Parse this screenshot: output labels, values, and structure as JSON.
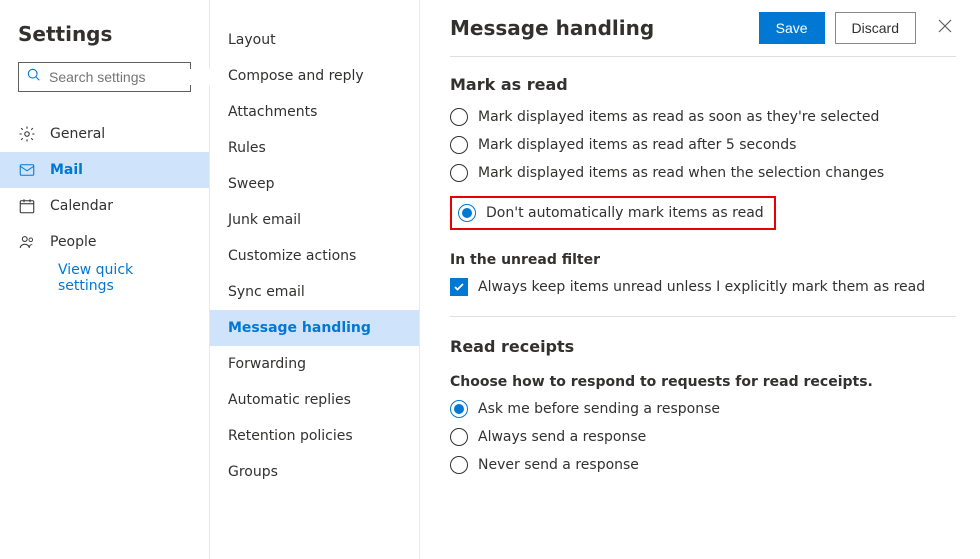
{
  "header": {
    "settings_title": "Settings",
    "search_placeholder": "Search settings"
  },
  "left_nav": {
    "general": "General",
    "mail": "Mail",
    "calendar": "Calendar",
    "people": "People",
    "quick_settings": "View quick settings"
  },
  "mid_nav": {
    "layout": "Layout",
    "compose": "Compose and reply",
    "attachments": "Attachments",
    "rules": "Rules",
    "sweep": "Sweep",
    "junk": "Junk email",
    "customize": "Customize actions",
    "sync": "Sync email",
    "message_handling": "Message handling",
    "forwarding": "Forwarding",
    "auto_replies": "Automatic replies",
    "retention": "Retention policies",
    "groups": "Groups"
  },
  "panel": {
    "title": "Message handling",
    "save": "Save",
    "discard": "Discard",
    "mark_as_read_title": "Mark as read",
    "mark_options": {
      "soon": "Mark displayed items as read as soon as they're selected",
      "after5": "Mark displayed items as read after 5 seconds",
      "selection": "Mark displayed items as read when the selection changes",
      "dont": "Don't automatically mark items as read"
    },
    "unread_filter_title": "In the unread filter",
    "unread_checkbox": "Always keep items unread unless I explicitly mark them as read",
    "read_receipts_title": "Read receipts",
    "read_receipts_meta": "Choose how to respond to requests for read receipts.",
    "receipt_options": {
      "ask": "Ask me before sending a response",
      "always": "Always send a response",
      "never": "Never send a response"
    }
  }
}
